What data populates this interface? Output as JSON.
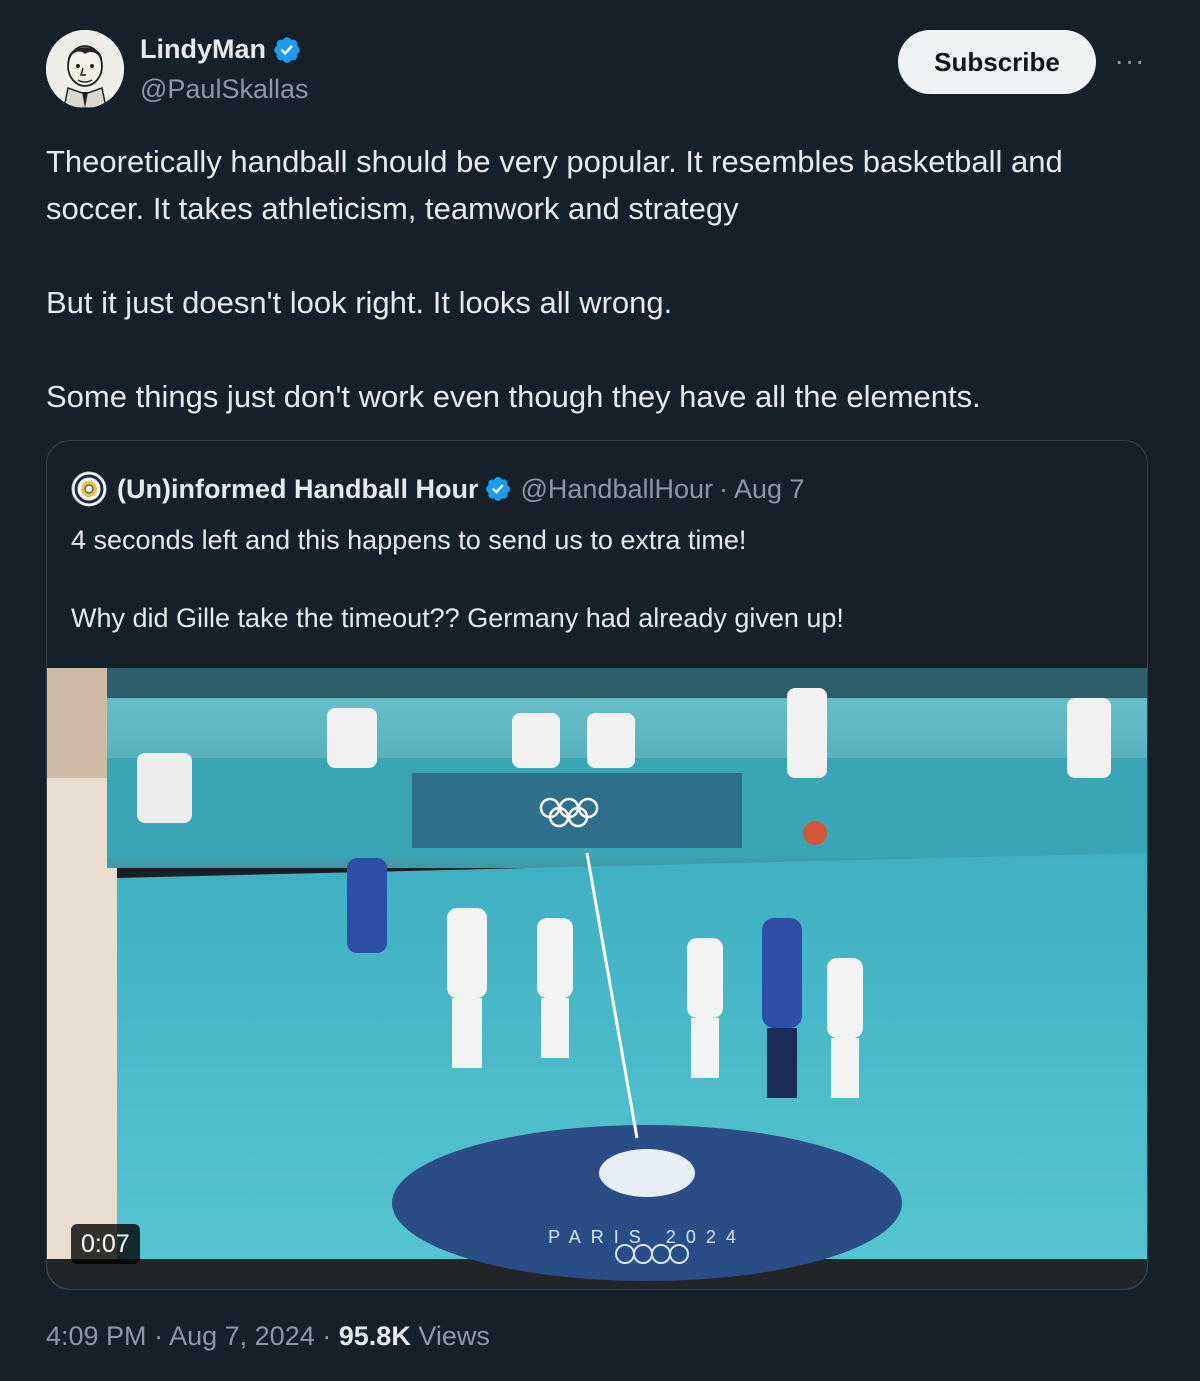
{
  "author": {
    "name": "LindyMan",
    "handle": "@PaulSkallas",
    "verified": true
  },
  "subscribe_label": "Subscribe",
  "more_label": "···",
  "tweet_text": {
    "p1": "Theoretically handball should be very popular. It resembles basketball and soccer. It takes athleticism, teamwork and strategy",
    "p2": "But it just doesn't look right. It looks all wrong.",
    "p3": "Some things just don't work even though they have all the elements."
  },
  "quoted_tweet": {
    "name": "(Un)informed Handball Hour",
    "handle": "@HandballHour",
    "separator": "·",
    "date": "Aug 7",
    "verified": true,
    "text_p1": "4 seconds left and this happens to send us to extra time!",
    "text_p2": "Why did Gille take the timeout?? Germany had already given up!",
    "media": {
      "type": "video",
      "duration": "0:07",
      "scene_text": {
        "venue": "PARIS 2024"
      }
    }
  },
  "meta": {
    "time": "4:09 PM",
    "sep1": "·",
    "date": "Aug 7, 2024",
    "sep2": "·",
    "views_count": "95.8K",
    "views_label": "Views"
  },
  "colors": {
    "background": "#15202b",
    "text": "#e7e9ea",
    "secondary": "#8b98a5",
    "verified_blue": "#1d9bf0",
    "border": "#38444d",
    "court_blue": "#46b9c9"
  },
  "icons": {
    "verified": "verified-badge-icon",
    "more": "more-icon"
  }
}
